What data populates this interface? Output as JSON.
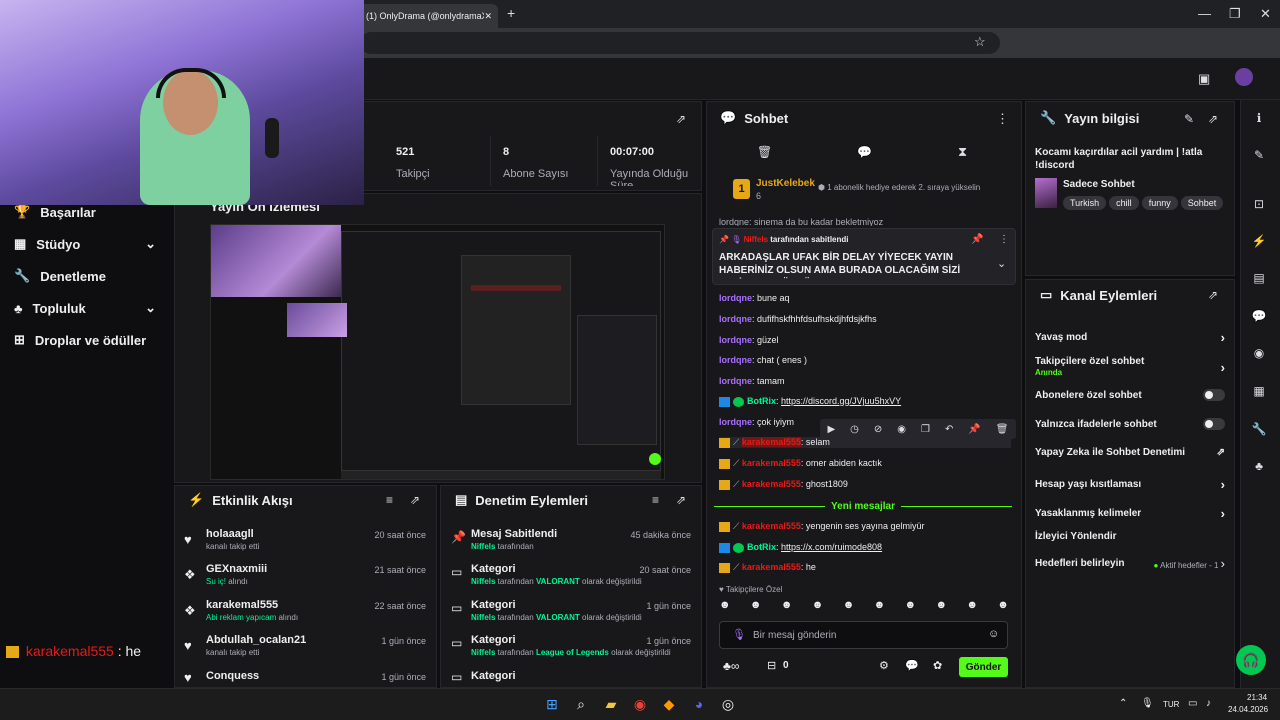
{
  "browser": {
    "tab_title": "(1) OnlyDrama (@onlydramaX)",
    "tab_close": "✕",
    "new_tab": "+",
    "minimize": "—",
    "restore": "❐",
    "close": "✕"
  },
  "left_nav": {
    "items": [
      {
        "label": "Başarılar"
      },
      {
        "label": "Stüdyo"
      },
      {
        "label": "Denetleme"
      },
      {
        "label": "Topluluk"
      },
      {
        "label": "Droplar ve ödüller"
      }
    ]
  },
  "stats": {
    "items": [
      {
        "value": "521",
        "label": "Takipçi"
      },
      {
        "value": "8",
        "label": "Abone Sayısı"
      },
      {
        "value": "00:07:00",
        "label": "Yayında Olduğu Süre"
      }
    ]
  },
  "preview": {
    "title": "Yayın Ön İzlemesi"
  },
  "activity": {
    "title": "Etkinlik Akışı",
    "items": [
      {
        "user": "holaaagll",
        "sub": "kanalı takip etti",
        "time": "20 saat önce",
        "icon": "heart-icon"
      },
      {
        "user": "GEXnaxmiii",
        "sub_hl": "Su iç!",
        "sub": " alındı",
        "time": "21 saat önce",
        "icon": "reward-icon"
      },
      {
        "user": "karakemal555",
        "sub_hl": "Abi reklam yapıcam",
        "sub": " alındı",
        "time": "22 saat önce",
        "icon": "reward-icon"
      },
      {
        "user": "Abdullah_ocalan21",
        "sub": "kanalı takip etti",
        "time": "1 gün önce",
        "icon": "heart-icon"
      },
      {
        "user": "Conquess",
        "sub": "",
        "time": "1 gün önce",
        "icon": "heart-icon"
      }
    ]
  },
  "moderation": {
    "title": "Denetim Eylemleri",
    "items": [
      {
        "title": "Mesaj Sabitlendi",
        "actor": "Niffels",
        "mid": " tarafından",
        "hl": "",
        "tail": "",
        "time": "45 dakika önce"
      },
      {
        "title": "Kategori",
        "actor": "Niffels",
        "mid": " tarafından ",
        "hl": "VALORANT",
        "tail": " olarak değiştirildi",
        "time": "20 saat önce"
      },
      {
        "title": "Kategori",
        "actor": "Niffels",
        "mid": " tarafından ",
        "hl": "VALORANT",
        "tail": " olarak değiştirildi",
        "time": "1 gün önce"
      },
      {
        "title": "Kategori",
        "actor": "Niffels",
        "mid": " tarafından ",
        "hl": "League of Legends",
        "tail": " olarak değiştirildi",
        "time": "1 gün önce"
      },
      {
        "title": "Kategori",
        "actor": "",
        "mid": "",
        "hl": "",
        "tail": "",
        "time": ""
      }
    ]
  },
  "chat": {
    "title": "Sohbet",
    "gift_user": "JustKelebek",
    "gift_count": "6",
    "gift_rank": "1",
    "gift_text": "1 abonelik hediye ederek 2. sıraya yükselin",
    "truncated_line": "lordqne: sinema da bu kadar bekletmiyoz",
    "pinned_by": "Niffels",
    "pinned_by_suffix": " tarafından sabitlendi",
    "pinned_text": "ARKADAŞLAR UFAK BİR DELAY YİYECEK YAYIN HABERİNİZ OLSUN AMA BURADA OLACAĞIM SİZİ SEVİYORUM ÖOTÜ...",
    "messages": [
      {
        "user": "lordqne",
        "text": "bune aq",
        "color": "#a970ff"
      },
      {
        "user": "lordqne",
        "text": "dufifhskfhhfdsufhskdjhfdsjkfhs",
        "color": "#a970ff"
      },
      {
        "user": "lordqne",
        "text": "güzel",
        "color": "#a970ff"
      },
      {
        "user": "lordqne",
        "text": "chat ( enes )",
        "color": "#a970ff"
      },
      {
        "user": "lordqne",
        "text": "tamam",
        "color": "#a970ff"
      },
      {
        "user": "BotRix",
        "text": "https://discord.gg/JVjuu5hxVY",
        "color": "#00f593",
        "link": true
      },
      {
        "user": "lordqne",
        "text": "çok iyiym",
        "color": "#a970ff"
      },
      {
        "user": "karakemal555",
        "text": "selam",
        "color": "#e91916",
        "highlight": true
      },
      {
        "user": "karakemal555",
        "text": "omer abiden kactık",
        "color": "#e91916"
      },
      {
        "user": "karakemal555",
        "text": "ghost1809",
        "color": "#e91916"
      }
    ],
    "new_messages": "Yeni mesajlar",
    "new": [
      {
        "user": "karakemal555",
        "text": "yengenin ses yayına gelmiyür",
        "color": "#e91916"
      },
      {
        "user": "BotRix",
        "text": "https://x.com/ruimode808",
        "color": "#00f593",
        "link": true
      },
      {
        "user": "karakemal555",
        "text": "he",
        "color": "#e91916"
      }
    ],
    "followers_only": "Takipçilere Özel",
    "input_placeholder": "Bir mesaj gönderin",
    "points": "0",
    "send": "Gönder"
  },
  "stream_info": {
    "title": "Yayın bilgisi",
    "stream_title": "Kocamı kaçırdılar acil yardım | !atla !discord",
    "category": "Sadece Sohbet",
    "tags": [
      "Turkish",
      "chill",
      "funny",
      "Sohbet"
    ]
  },
  "channel_actions": {
    "title": "Kanal Eylemleri",
    "items": [
      {
        "label": "Yavaş mod",
        "ctrl": "chevron"
      },
      {
        "label": "Takipçilere özel sohbet",
        "sub": "Anında",
        "ctrl": "chevron"
      },
      {
        "label": "Abonelere özel sohbet",
        "ctrl": "toggle"
      },
      {
        "label": "Yalnızca ifadelerle sohbet",
        "ctrl": "toggle"
      },
      {
        "label": "Yapay Zeka ile Sohbet Denetimi",
        "ctrl": "external"
      },
      {
        "label": "Hesap yaşı kısıtlaması",
        "ctrl": "chevron"
      },
      {
        "label": "Yasaklanmış kelimeler",
        "ctrl": "chevron"
      },
      {
        "label": "İzleyici Yönlendir",
        "ctrl": ""
      },
      {
        "label": "Hedefleri belirleyin",
        "extra": "Aktif hedefler - 1",
        "ctrl": "chevron"
      }
    ]
  },
  "overlay": {
    "user": "karakemal555",
    "sep": " : ",
    "text": "he"
  },
  "taskbar": {
    "lang": "TUR",
    "time": "21:34",
    "date": "24.04.2026"
  },
  "colors": {
    "accent": "#53fc18",
    "bg": "#0e0e10",
    "panel": "#18181b",
    "purple": "#a970ff",
    "red": "#e91916"
  }
}
